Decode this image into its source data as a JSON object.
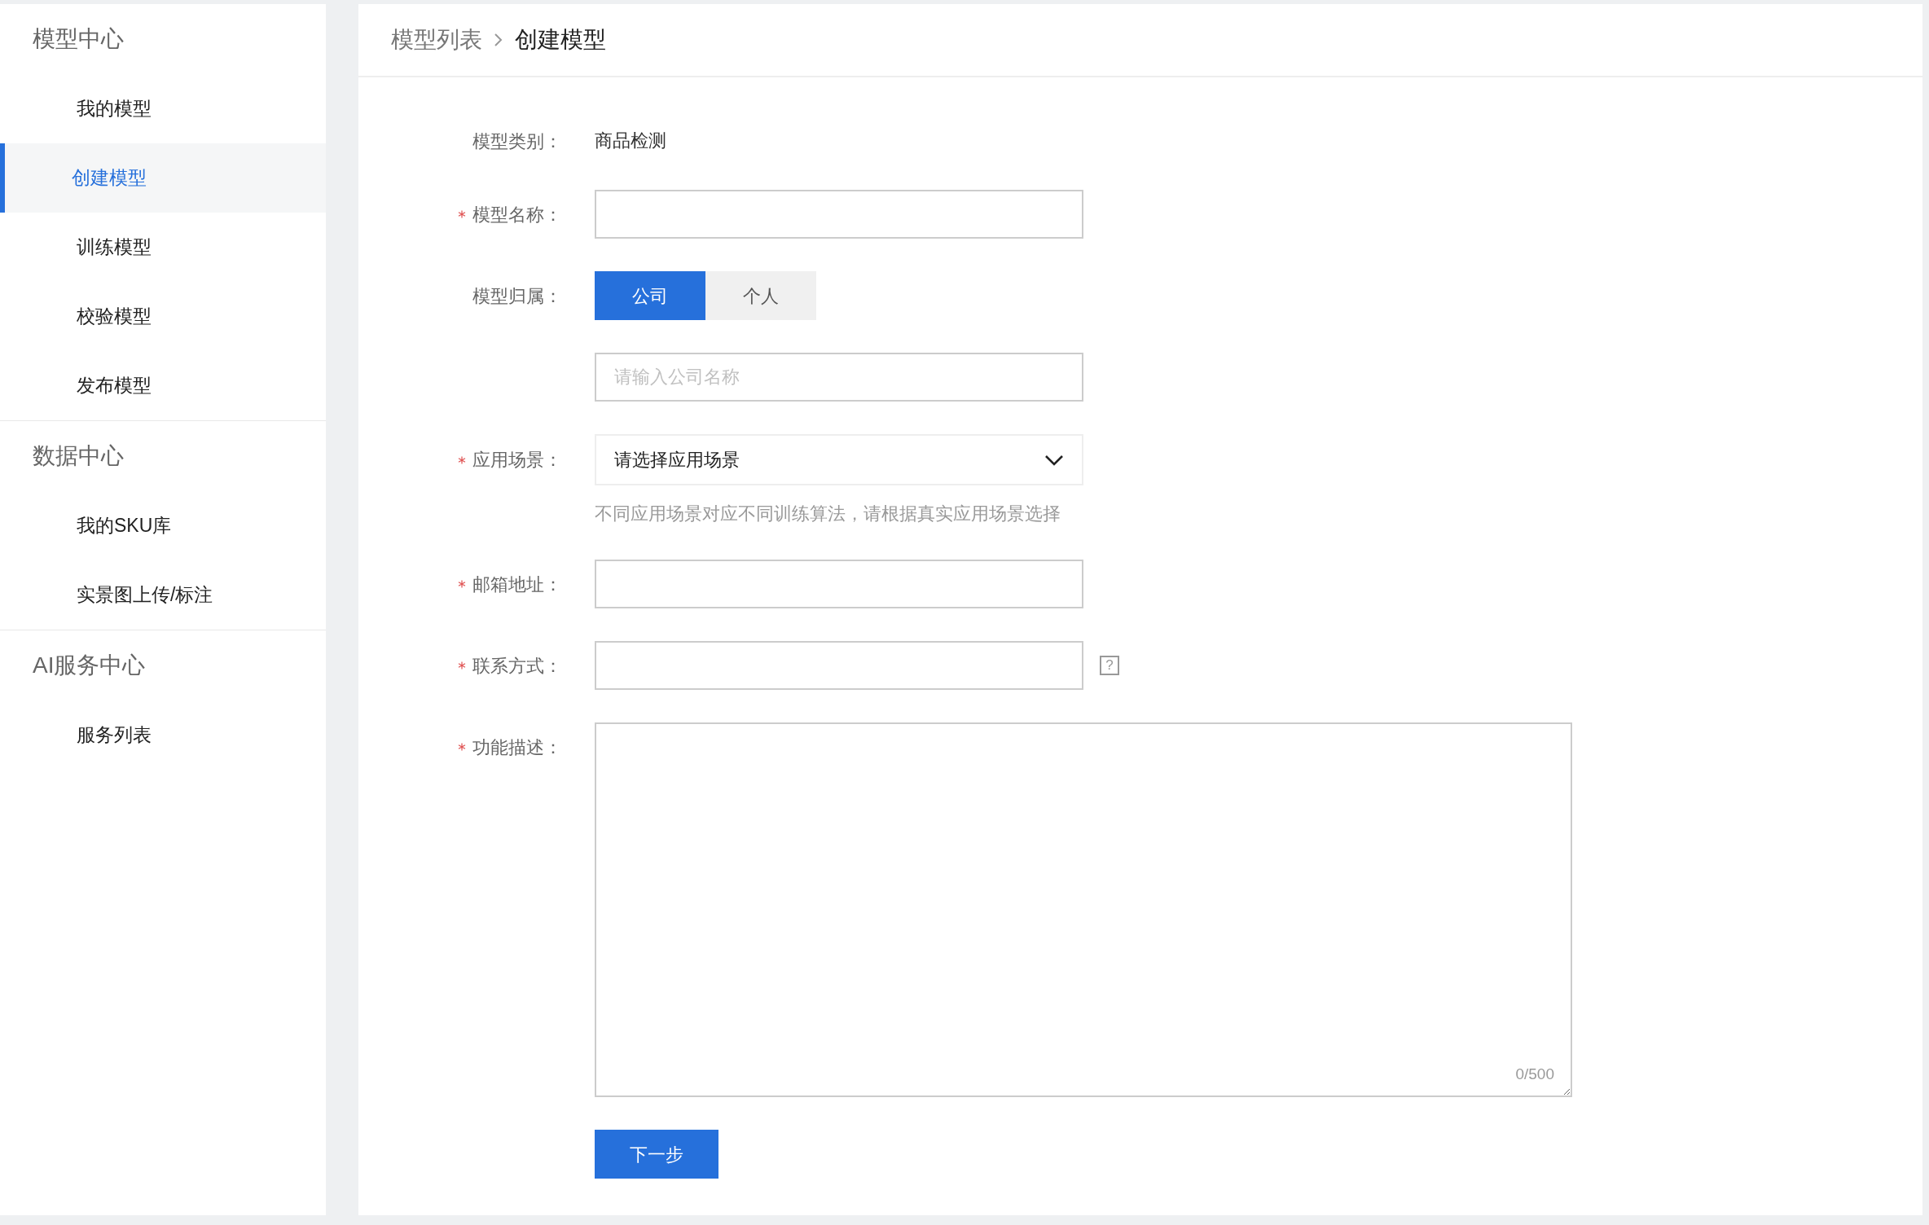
{
  "sidebar": {
    "groups": [
      {
        "title": "模型中心",
        "items": [
          {
            "label": "我的模型",
            "selected": false
          },
          {
            "label": "创建模型",
            "selected": true
          },
          {
            "label": "训练模型",
            "selected": false
          },
          {
            "label": "校验模型",
            "selected": false
          },
          {
            "label": "发布模型",
            "selected": false
          }
        ]
      },
      {
        "title": "数据中心",
        "items": [
          {
            "label": "我的SKU库",
            "selected": false
          },
          {
            "label": "实景图上传/标注",
            "selected": false
          }
        ]
      },
      {
        "title": "AI服务中心",
        "items": [
          {
            "label": "服务列表",
            "selected": false
          }
        ]
      }
    ]
  },
  "breadcrumb": [
    {
      "label": "模型列表"
    },
    {
      "label": "创建模型"
    }
  ],
  "form": {
    "fields": [
      {
        "kind": "text",
        "label": "模型类别：",
        "required": false,
        "value": "商品检测"
      },
      {
        "kind": "input",
        "label": "模型名称：",
        "required": true
      },
      {
        "kind": "segmented",
        "label": "模型归属：",
        "required": false,
        "options": [
          {
            "label": "公司",
            "selected": true
          },
          {
            "label": "个人",
            "selected": false
          }
        ]
      },
      {
        "kind": "input",
        "required": false,
        "placeholder": "请输入公司名称"
      },
      {
        "kind": "select",
        "label": "应用场景：",
        "required": true,
        "value": "请选择应用场景",
        "hint": "不同应用场景对应不同训练算法，请根据真实应用场景选择"
      },
      {
        "kind": "input",
        "label": "邮箱地址：",
        "required": true
      },
      {
        "kind": "input",
        "label": "联系方式：",
        "required": true,
        "help": "?"
      },
      {
        "kind": "textarea",
        "label": "功能描述：",
        "required": true,
        "counter": "0/500"
      }
    ],
    "submit": "下一步"
  }
}
